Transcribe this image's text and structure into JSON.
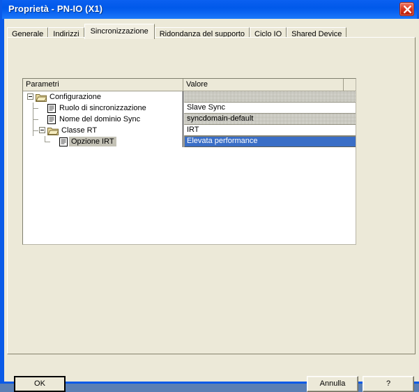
{
  "window": {
    "title": "Proprietà - PN-IO (X1)",
    "close_icon": "close-icon",
    "titlebar_color": "#0a5ae8",
    "dialog_bg": "#ece9d8",
    "selection_color": "#3a6ec6"
  },
  "tabs": [
    {
      "label": "Generale",
      "active": false
    },
    {
      "label": "Indirizzi",
      "active": false
    },
    {
      "label": "Sincronizzazione",
      "active": true
    },
    {
      "label": "Ridondanza del supporto",
      "active": false
    },
    {
      "label": "Ciclo IO",
      "active": false
    },
    {
      "label": "Shared Device",
      "active": false
    }
  ],
  "grid": {
    "columns": [
      "Parametri",
      "Valore"
    ],
    "rows": [
      {
        "label": "Configurazione",
        "value": "",
        "icon": "folder-open-icon",
        "depth": 0,
        "expander": "minus",
        "value_style": "dither",
        "label_selected": false
      },
      {
        "label": "Ruolo di sincronizzazione",
        "value": "Slave Sync",
        "icon": "document-icon",
        "depth": 1,
        "expander": "none",
        "value_style": "plain",
        "label_selected": false
      },
      {
        "label": "Nome del dominio Sync",
        "value": "syncdomain-default",
        "icon": "document-icon",
        "depth": 1,
        "expander": "none",
        "value_style": "dither",
        "label_selected": false
      },
      {
        "label": "Classe RT",
        "value": "IRT",
        "icon": "folder-open-icon",
        "depth": 1,
        "expander": "minus",
        "value_style": "plain",
        "label_selected": false
      },
      {
        "label": "Opzione IRT",
        "value": "Elevata performance",
        "icon": "document-icon",
        "depth": 2,
        "expander": "none",
        "value_style": "selected",
        "label_selected": true
      }
    ]
  },
  "buttons": {
    "ok": "OK",
    "cancel": "Annulla",
    "help": "?"
  }
}
